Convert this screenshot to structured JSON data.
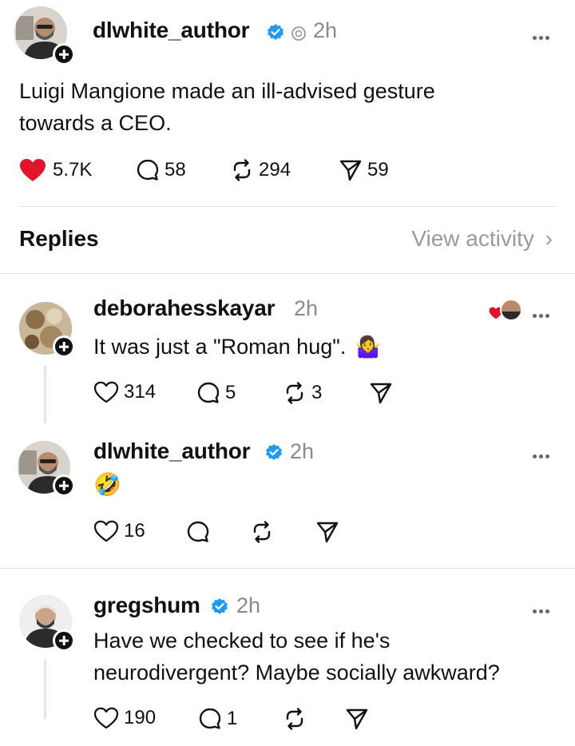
{
  "post": {
    "username": "dlwhite_author",
    "time": "2h",
    "text_line1": "Luigi Mangione made an ill-advised gesture",
    "text_line2": "towards a CEO.",
    "likes": "5.7K",
    "comments": "58",
    "reposts": "294",
    "shares": "59"
  },
  "replies_header": {
    "label": "Replies",
    "view_activity": "View activity"
  },
  "replies": [
    {
      "username": "deborahesskayar",
      "time": "2h",
      "text": "It was just a \"Roman hug\".",
      "emoji": "🤷‍♀️",
      "likes": "314",
      "comments": "5",
      "reposts": "3"
    },
    {
      "username": "dlwhite_author",
      "time": "2h",
      "emoji": "🤣",
      "likes": "16"
    },
    {
      "username": "gregshum",
      "time": "2h",
      "text_line1": "Have we checked to see if he's",
      "text_line2": "neurodivergent? Maybe socially awkward?",
      "likes": "190",
      "comments": "1"
    }
  ],
  "colors": {
    "heart_liked": "#e0142c",
    "verified": "#1d9bf0",
    "muted": "#8a8a8a",
    "divider": "#e2e2e2"
  }
}
